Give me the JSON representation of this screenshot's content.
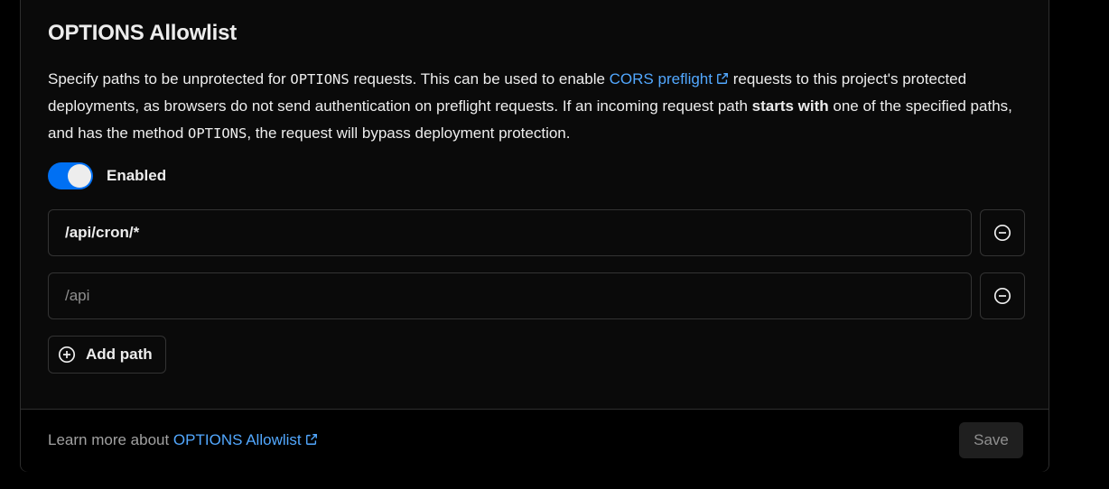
{
  "section": {
    "title": "OPTIONS Allowlist",
    "description": {
      "part1": "Specify paths to be unprotected for ",
      "code1": "OPTIONS",
      "part2": " requests. This can be used to enable ",
      "link_text": "CORS preflight",
      "part3": " requests to this project's protected deployments, as browsers do not send authentication on preflight requests. If an incoming request path ",
      "bold": "starts with",
      "part4": " one of the specified paths, and has the method ",
      "code2": "OPTIONS",
      "part5": ", the request will bypass deployment protection."
    }
  },
  "toggle": {
    "label": "Enabled",
    "state": "on",
    "color": "#0070f3"
  },
  "paths": [
    {
      "value": "/api/cron/*",
      "placeholder": ""
    },
    {
      "value": "",
      "placeholder": "/api"
    }
  ],
  "add_button": {
    "label": "Add path",
    "icon": "plus-circle-icon"
  },
  "remove_icon": "minus-circle-icon",
  "footer": {
    "prefix": "Learn more about ",
    "link_text": "OPTIONS Allowlist",
    "save_label": "Save"
  },
  "colors": {
    "link": "#52a8ff",
    "background": "#0a0a0a",
    "border": "#2e2e2e"
  }
}
